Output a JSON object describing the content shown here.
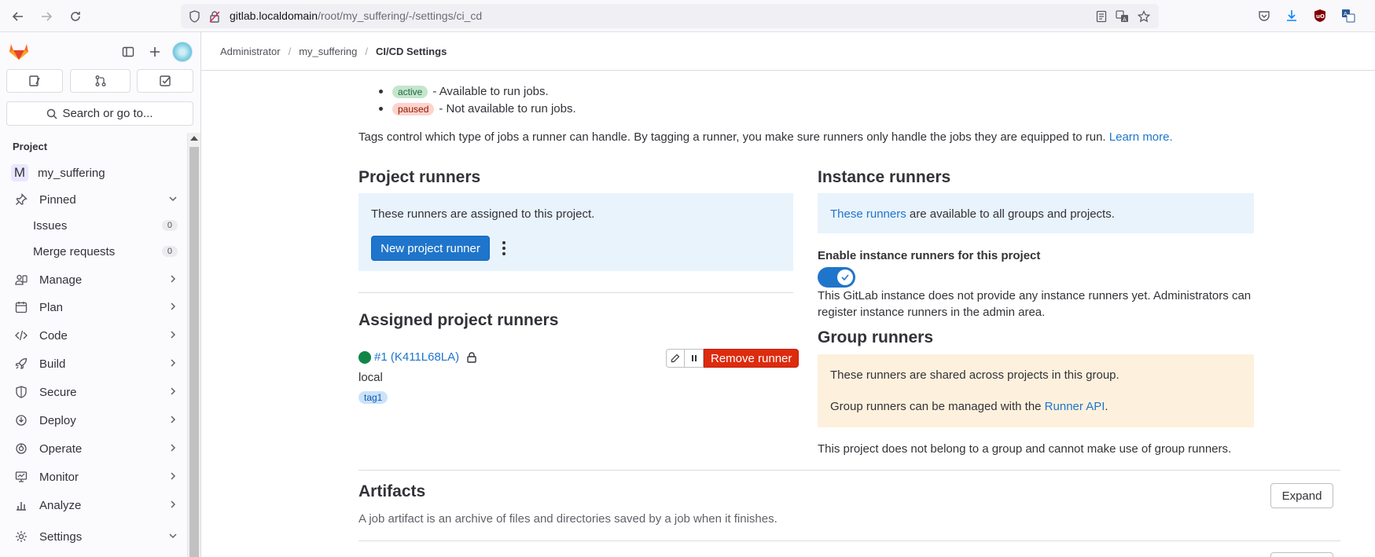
{
  "browser": {
    "url_host": "gitlab.localdomain",
    "url_path": "/root/my_suffering/-/settings/ci_cd"
  },
  "sidebar": {
    "search_label": "Search or go to...",
    "section_title": "Project",
    "project_initial": "M",
    "project_name": "my_suffering",
    "pinned_label": "Pinned",
    "pinned_items": [
      {
        "label": "Issues",
        "count": "0"
      },
      {
        "label": "Merge requests",
        "count": "0"
      }
    ],
    "nav_items": [
      {
        "label": "Manage",
        "icon": "users-icon"
      },
      {
        "label": "Plan",
        "icon": "calendar-icon"
      },
      {
        "label": "Code",
        "icon": "code-icon"
      },
      {
        "label": "Build",
        "icon": "rocket-icon"
      },
      {
        "label": "Secure",
        "icon": "shield-icon"
      },
      {
        "label": "Deploy",
        "icon": "deploy-icon"
      },
      {
        "label": "Operate",
        "icon": "operate-icon"
      },
      {
        "label": "Monitor",
        "icon": "monitor-icon"
      },
      {
        "label": "Analyze",
        "icon": "chart-icon"
      },
      {
        "label": "Settings",
        "icon": "gear-icon"
      }
    ]
  },
  "breadcrumb": {
    "items": [
      "Administrator",
      "my_suffering",
      "CI/CD Settings"
    ]
  },
  "status_list": [
    {
      "badge": "active",
      "text": "- Available to run jobs."
    },
    {
      "badge": "paused",
      "text": "- Not available to run jobs."
    }
  ],
  "tags_text": "Tags control which type of jobs a runner can handle. By tagging a runner, you make sure runners only handle the jobs they are equipped to run.",
  "learn_more": "Learn more.",
  "project_runners": {
    "title": "Project runners",
    "info": "These runners are assigned to this project.",
    "new_button": "New project runner",
    "assigned_title": "Assigned project runners",
    "runner_link": "#1 (K411L68LA)",
    "runner_desc": "local",
    "runner_tag": "tag1",
    "remove_button": "Remove runner"
  },
  "instance_runners": {
    "title": "Instance runners",
    "info_link": "These runners",
    "info_rest": "are available to all groups and projects.",
    "toggle_label": "Enable instance runners for this project",
    "toggle_on": true,
    "note": "This GitLab instance does not provide any instance runners yet. Administrators can register instance runners in the admin area."
  },
  "group_runners": {
    "title": "Group runners",
    "line1": "These runners are shared across projects in this group.",
    "line2_prefix": "Group runners can be managed with the",
    "line2_link": "Runner API",
    "line2_suffix": ".",
    "note": "This project does not belong to a group and cannot make use of group runners."
  },
  "artifacts": {
    "title": "Artifacts",
    "desc": "A job artifact is an archive of files and directories saved by a job when it finishes.",
    "expand_button": "Expand"
  }
}
